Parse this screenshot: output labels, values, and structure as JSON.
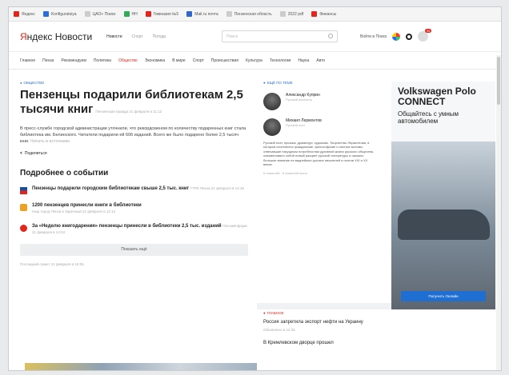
{
  "bookmarks": [
    "Яндекс",
    "Konfiguratsiya",
    "ЦАО+ Поиск",
    "HH",
    "Гимназия №5",
    "Mail.ru почта",
    "Пензенская область",
    "2022 pdf",
    "Финансы"
  ],
  "header": {
    "logo_main": "ндекс",
    "logo_y": "Я",
    "logo_news": " Новости",
    "nav": [
      "Новости",
      "Спорт",
      "Погода"
    ],
    "search_placeholder": "Поиск",
    "login": "Войти в Поиск",
    "badge": "99"
  },
  "rubrics": [
    "Главное",
    "Пенза",
    "Рекомендуем",
    "Политика",
    "Общество",
    "Экономика",
    "В мире",
    "Спорт",
    "Происшествия",
    "Культура",
    "Технологии",
    "Наука",
    "Авто"
  ],
  "article": {
    "tag": "Общество",
    "title": "Пензенцы подарили библиотекам 2,5 тысячи книг",
    "source": "Пензенская правда 21 февраля в 11:12",
    "lead": "В пресс-службе городской администрации уточнили, что рекордсменом по количеству подаренных книг стала библиотека им. Белинского. Читатели подарили ей 606 изданий. Всего же было подарено более 2,5 тысяч книг.",
    "more": "Читать в источнике",
    "share": "Поделиться"
  },
  "events": {
    "title": "Подробнее о событии",
    "items": [
      {
        "t": "Пензенцы подарили городским библиотекам свыше 2,5 тыс. книг",
        "m": "ГТРК Пенза 21 февраля в 14:18"
      },
      {
        "t": "1200 пензенцев принесли книги в библиотеки",
        "m": "Наш город Пенза в Заречный 21 февраля в 12:12"
      },
      {
        "t": "За «Неделю книгодарения» пензенцы принесли в библиотеки 2,5 тыс. изданий",
        "m": "ПензаИнформ 21 февраля в 14:04"
      }
    ],
    "showmore": "Показать ещё",
    "updated": "Последний сюжет 21 февраля в 15:05"
  },
  "sidecol": {
    "title": "Ещё по теме",
    "persons": [
      {
        "name": "Александр Куприн",
        "role": "Русский писатель"
      },
      {
        "name": "Михаил Лермонтов",
        "role": "Русский поэт"
      }
    ],
    "bio": "Русский поэт, прозаик, драматург, художник. Творчество Лермонтова, в котором сочетаются гражданские, философские и личные мотивы, отвечавшие насущным потребностям духовной жизни русского общества, ознаменовало собой новый расцвет русской литературы и оказало большое влияние на виднейших русских писателей и поэтов XIX и XX веков.",
    "foot": "6 новостей · 8 новостей всего"
  },
  "ad": {
    "brand": "Volkswagen Polo CONNECT",
    "sub": "Общайтесь с умным автомобилем",
    "cta": "Получить Онлайн"
  },
  "trending": {
    "tag": "Главное",
    "h1": "Россия запретила экспорт нефти на Украину",
    "d1": "Обновлено в 12:25",
    "h2": "В Кремлевском дворце прошел"
  },
  "colors": {
    "accent": "#e4251b",
    "link": "#2a6fd6"
  }
}
